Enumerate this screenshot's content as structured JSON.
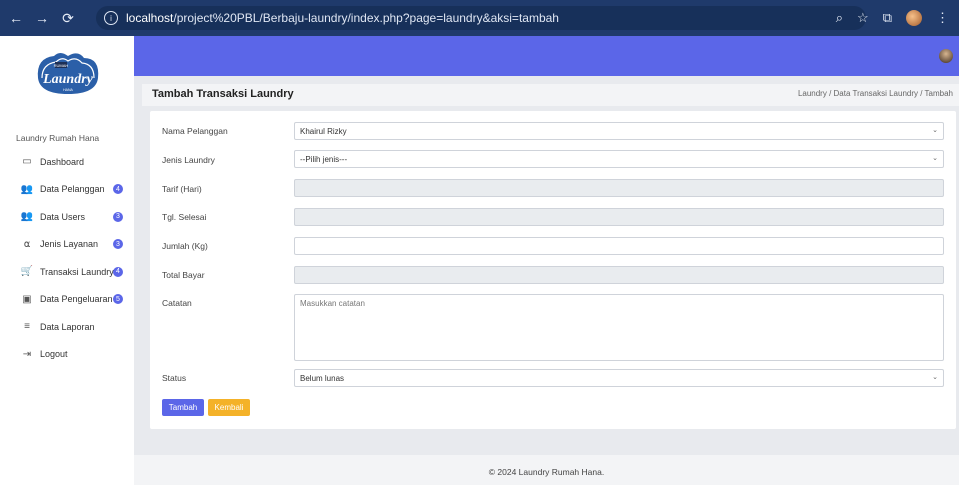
{
  "browser": {
    "url_host": "localhost",
    "url_path": "/project%20PBL/Berbaju-laundry/index.php?page=laundry&aksi=tambah"
  },
  "sidebar": {
    "logo_text_top": "RUMAH",
    "logo_text_main": "Laundry",
    "logo_text_bottom": "HANA",
    "title": "Laundry Rumah Hana",
    "items": [
      {
        "label": "Dashboard",
        "icon": "monitor-icon",
        "badge": null
      },
      {
        "label": "Data Pelanggan",
        "icon": "users-icon",
        "badge": "4"
      },
      {
        "label": "Data Users",
        "icon": "users-icon",
        "badge": "3"
      },
      {
        "label": "Jenis Layanan",
        "icon": "service-icon",
        "badge": "3"
      },
      {
        "label": "Transaksi Laundry",
        "icon": "cart-icon",
        "badge": "4"
      },
      {
        "label": "Data Pengeluaran",
        "icon": "wallet-icon",
        "badge": "5"
      },
      {
        "label": "Data Laporan",
        "icon": "list-icon",
        "badge": null
      },
      {
        "label": "Logout",
        "icon": "logout-icon",
        "badge": null
      }
    ]
  },
  "header": {
    "title": "Tambah Transaksi Laundry",
    "breadcrumb": "Laundry  /  Data Transaksi Laundry  /  Tambah"
  },
  "form": {
    "nama_pelanggan_label": "Nama Pelanggan",
    "nama_pelanggan_value": "Khairul Rizky",
    "jenis_laundry_label": "Jenis Laundry",
    "jenis_laundry_value": "--Pilih jenis---",
    "tarif_label": "Tarif (Hari)",
    "tgl_selesai_label": "Tgl. Selesai",
    "jumlah_label": "Jumlah (Kg)",
    "total_bayar_label": "Total Bayar",
    "catatan_label": "Catatan",
    "catatan_placeholder": "Masukkan catatan",
    "status_label": "Status",
    "status_value": "Belum lunas",
    "submit_label": "Tambah",
    "back_label": "Kembali"
  },
  "footer": {
    "text": "© 2024 Laundry Rumah Hana."
  },
  "colors": {
    "primary": "#5b66e8",
    "warning": "#f4b229",
    "browser_bar": "#1f3a6b"
  }
}
